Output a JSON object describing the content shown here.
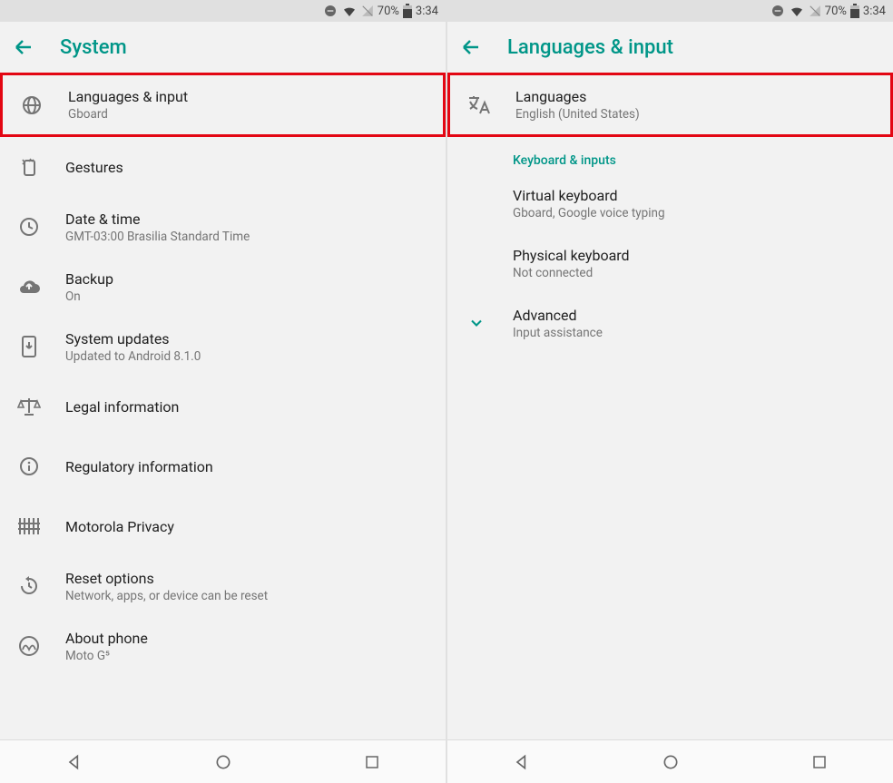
{
  "status": {
    "battery": "70%",
    "time": "3:34"
  },
  "left": {
    "title": "System",
    "items": [
      {
        "icon": "globe",
        "title": "Languages & input",
        "sub": "Gboard",
        "hl": true
      },
      {
        "icon": "gesture",
        "title": "Gestures",
        "sub": ""
      },
      {
        "icon": "clock",
        "title": "Date & time",
        "sub": "GMT-03:00 Brasilia Standard Time"
      },
      {
        "icon": "backup",
        "title": "Backup",
        "sub": "On"
      },
      {
        "icon": "update",
        "title": "System updates",
        "sub": "Updated to Android 8.1.0"
      },
      {
        "icon": "legal",
        "title": "Legal information",
        "sub": ""
      },
      {
        "icon": "info",
        "title": "Regulatory information",
        "sub": ""
      },
      {
        "icon": "privacy",
        "title": "Motorola Privacy",
        "sub": ""
      },
      {
        "icon": "reset",
        "title": "Reset options",
        "sub": "Network, apps, or device can be reset"
      },
      {
        "icon": "moto",
        "title": "About phone",
        "sub": "Moto G⁵"
      }
    ]
  },
  "right": {
    "title": "Languages & input",
    "items": [
      {
        "icon": "translate",
        "title": "Languages",
        "sub": "English (United States)",
        "hl": true
      }
    ],
    "section1": {
      "header": "Keyboard & inputs",
      "items": [
        {
          "title": "Virtual keyboard",
          "sub": "Gboard, Google voice typing"
        },
        {
          "title": "Physical keyboard",
          "sub": "Not connected"
        }
      ]
    },
    "advanced": {
      "title": "Advanced",
      "sub": "Input assistance"
    }
  }
}
